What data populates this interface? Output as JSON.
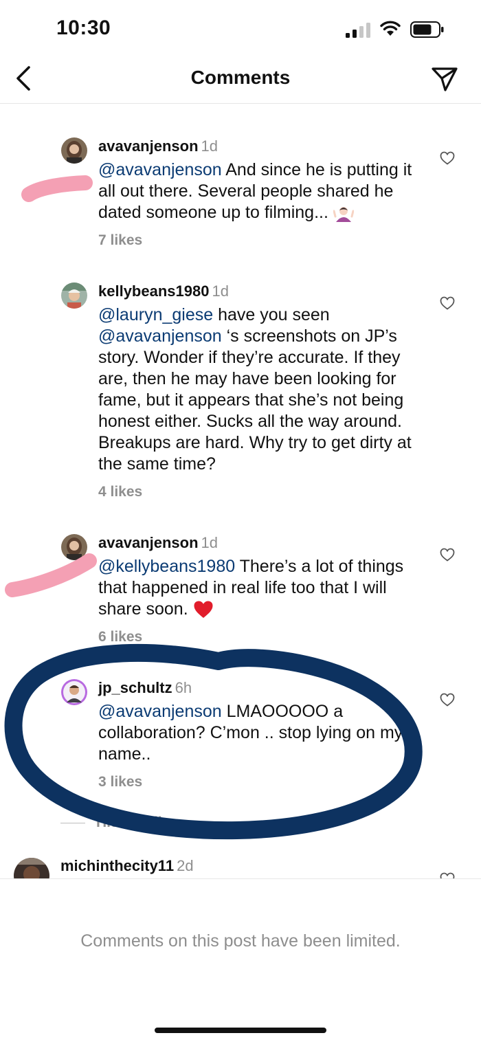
{
  "status_bar": {
    "time": "10:30"
  },
  "header": {
    "title": "Comments"
  },
  "comments": [
    {
      "username": "avavanjenson",
      "age": "1d",
      "mention": "@avavanjenson",
      "text": " And since he is putting it all out there. Several people shared he dated someone up to filming...",
      "emoji": "person-shrugging",
      "likes": "7 likes"
    },
    {
      "username": "kellybeans1980",
      "age": "1d",
      "mention": "@lauryn_giese",
      "text": " have you seen ",
      "mention2": "@avavanjenson",
      "text2": " ‘s screenshots on JP’s story. Wonder if they’re accurate. If they are, then he may have been looking for fame, but it appears that she’s not being honest either. Sucks all the way around. Breakups are hard. Why try to get dirty at the same time?",
      "likes": "4 likes"
    },
    {
      "username": "avavanjenson",
      "age": "1d",
      "mention": "@kellybeans1980",
      "text": " There’s a lot of things that happened in real life too that I will share soon. ",
      "emoji": "red-heart",
      "likes": "6 likes"
    },
    {
      "username": "jp_schultz",
      "age": "6h",
      "mention": "@avavanjenson",
      "text": " LMAOOOOO a collaboration? C’mon .. stop lying on my name..",
      "likes": "3 likes"
    }
  ],
  "hide_replies": "Hide replies",
  "last_comment": {
    "username": "michinthecity11",
    "age": "2d"
  },
  "footer": {
    "limited_text": "Comments on this post have been limited."
  },
  "annotation_colors": {
    "pink_marker": "#f4a0b4",
    "navy_circle": "#0d3260"
  }
}
